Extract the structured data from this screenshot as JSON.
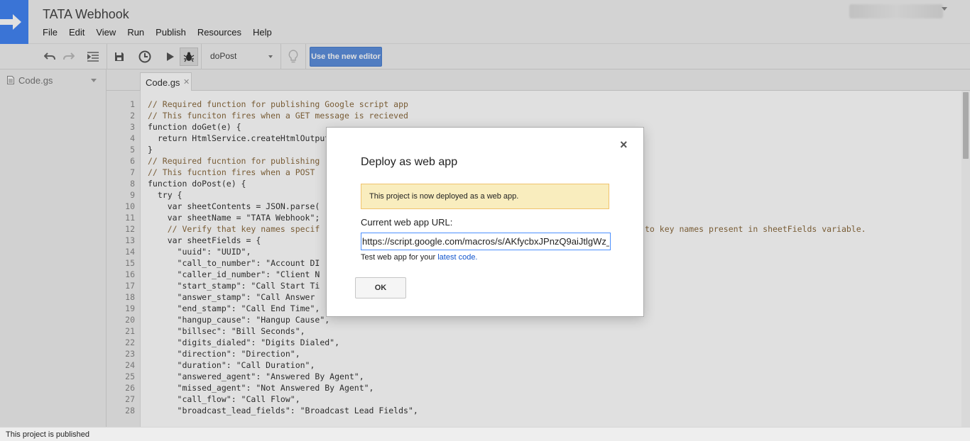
{
  "app": {
    "title": "TATA Webhook",
    "accent_color": "#4285f4"
  },
  "menu": {
    "items": [
      "File",
      "Edit",
      "View",
      "Run",
      "Publish",
      "Resources",
      "Help"
    ]
  },
  "toolbar": {
    "function_select": "doPost",
    "new_editor_label": "Use the new editor",
    "icons": [
      "undo-icon",
      "redo-icon",
      "indent-icon",
      "save-icon",
      "triggers-icon",
      "run-icon",
      "debug-icon",
      "lightbulb-icon"
    ]
  },
  "sidebar": {
    "file_name": "Code.gs"
  },
  "editor": {
    "tab_label": "Code.gs",
    "line_numbers": [
      "1",
      "2",
      "3",
      "4",
      "5",
      "6",
      "7",
      "8",
      "9",
      "10",
      "11",
      "12",
      "13",
      "14",
      "15",
      "16",
      "17",
      "18",
      "19",
      "20",
      "21",
      "22",
      "23",
      "24",
      "25",
      "26",
      "27",
      "28"
    ],
    "lines": [
      "// Required function for publishing Google script app",
      "// This funciton fires when a GET message is recieved",
      "function doGet(e) {",
      "  return HtmlService.createHtmlOutput",
      "}",
      "// Required fucntion for publishing",
      "// This fucntion fires when a POST",
      "function doPost(e) {",
      "  try {",
      "    var sheetContents = JSON.parse(",
      "    var sheetName = \"TATA Webhook\";",
      "    // Verify that key names specif",
      "    var sheetFields = {",
      "      \"uuid\": \"UUID\",",
      "      \"call_to_number\": \"Account DI",
      "      \"caller_id_number\": \"Client N",
      "      \"start_stamp\": \"Call Start Ti",
      "      \"answer_stamp\": \"Call Answer",
      "      \"end_stamp\": \"Call End Time\",",
      "      \"hangup_cause\": \"Hangup Cause\",",
      "      \"billsec\": \"Bill Seconds\",",
      "      \"digits_dialed\": \"Digits Dialed\",",
      "      \"direction\": \"Direction\",",
      "      \"duration\": \"Call Duration\",",
      "      \"answered_agent\": \"Answered By Agent\",",
      "      \"missed_agent\": \"Not Answered By Agent\",",
      "      \"call_flow\": \"Call Flow\",",
      "      \"broadcast_lead_fields\": \"Broadcast Lead Fields\","
    ],
    "line12_tail": "to key names present in sheetFields variable."
  },
  "status": {
    "text": "This project is published"
  },
  "dialog": {
    "title": "Deploy as web app",
    "notice": "This project is now deployed as a web app.",
    "url_label": "Current web app URL:",
    "url_value": "https://script.google.com/macros/s/AKfycbxJPnzQ9aiJtlgWz_",
    "test_prefix": "Test web app for your ",
    "test_link": "latest code.",
    "ok_label": "OK",
    "close_glyph": "×"
  }
}
